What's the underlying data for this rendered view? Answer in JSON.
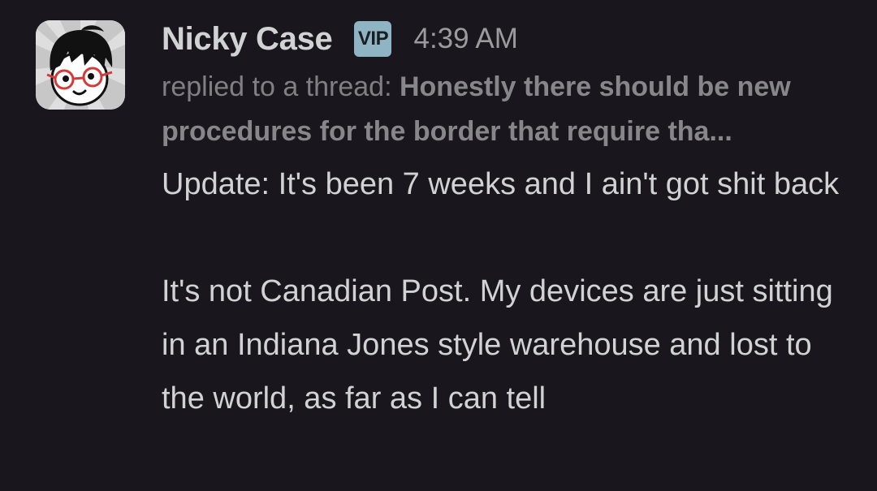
{
  "message": {
    "author": "Nicky Case",
    "badge": "VIP",
    "timestamp": "4:39 AM",
    "thread_prefix": "replied to a thread:",
    "thread_title": "Honestly there should be new procedures for the border that require tha...",
    "paragraphs": [
      "Update: It's been 7 weeks and I ain't got shit back",
      "It's not Canadian Post. My devices are just sitting in an Indiana Jones style warehouse and lost to the world, as far as I can tell"
    ]
  },
  "avatar_icon": "cartoon-face-with-red-glasses-icon"
}
